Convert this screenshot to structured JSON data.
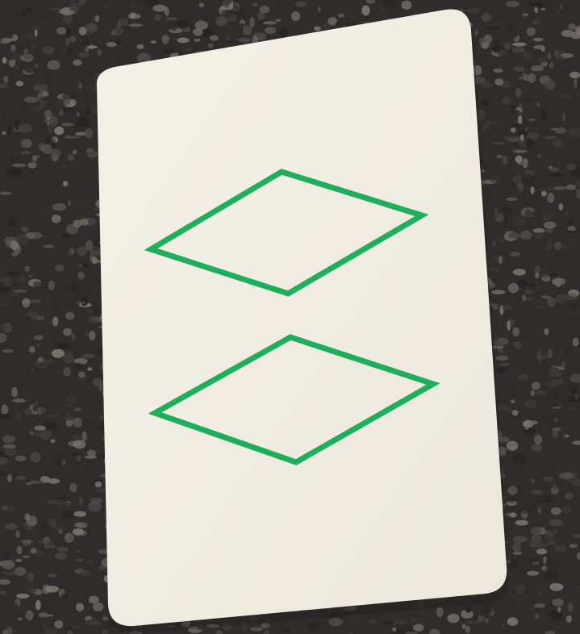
{
  "scene": {
    "background": "carpet",
    "carpet_colors": [
      "#2f2d2b",
      "#4a4541",
      "#5b5550",
      "#3c3936",
      "#6b655e",
      "#262422",
      "#7a746c"
    ]
  },
  "card": {
    "color": "#f1eee4",
    "shadow_color": "#d9d5c9",
    "symbol": {
      "shape": "diamond",
      "count": 2,
      "fill": "open",
      "color": "#1fae5b"
    }
  }
}
